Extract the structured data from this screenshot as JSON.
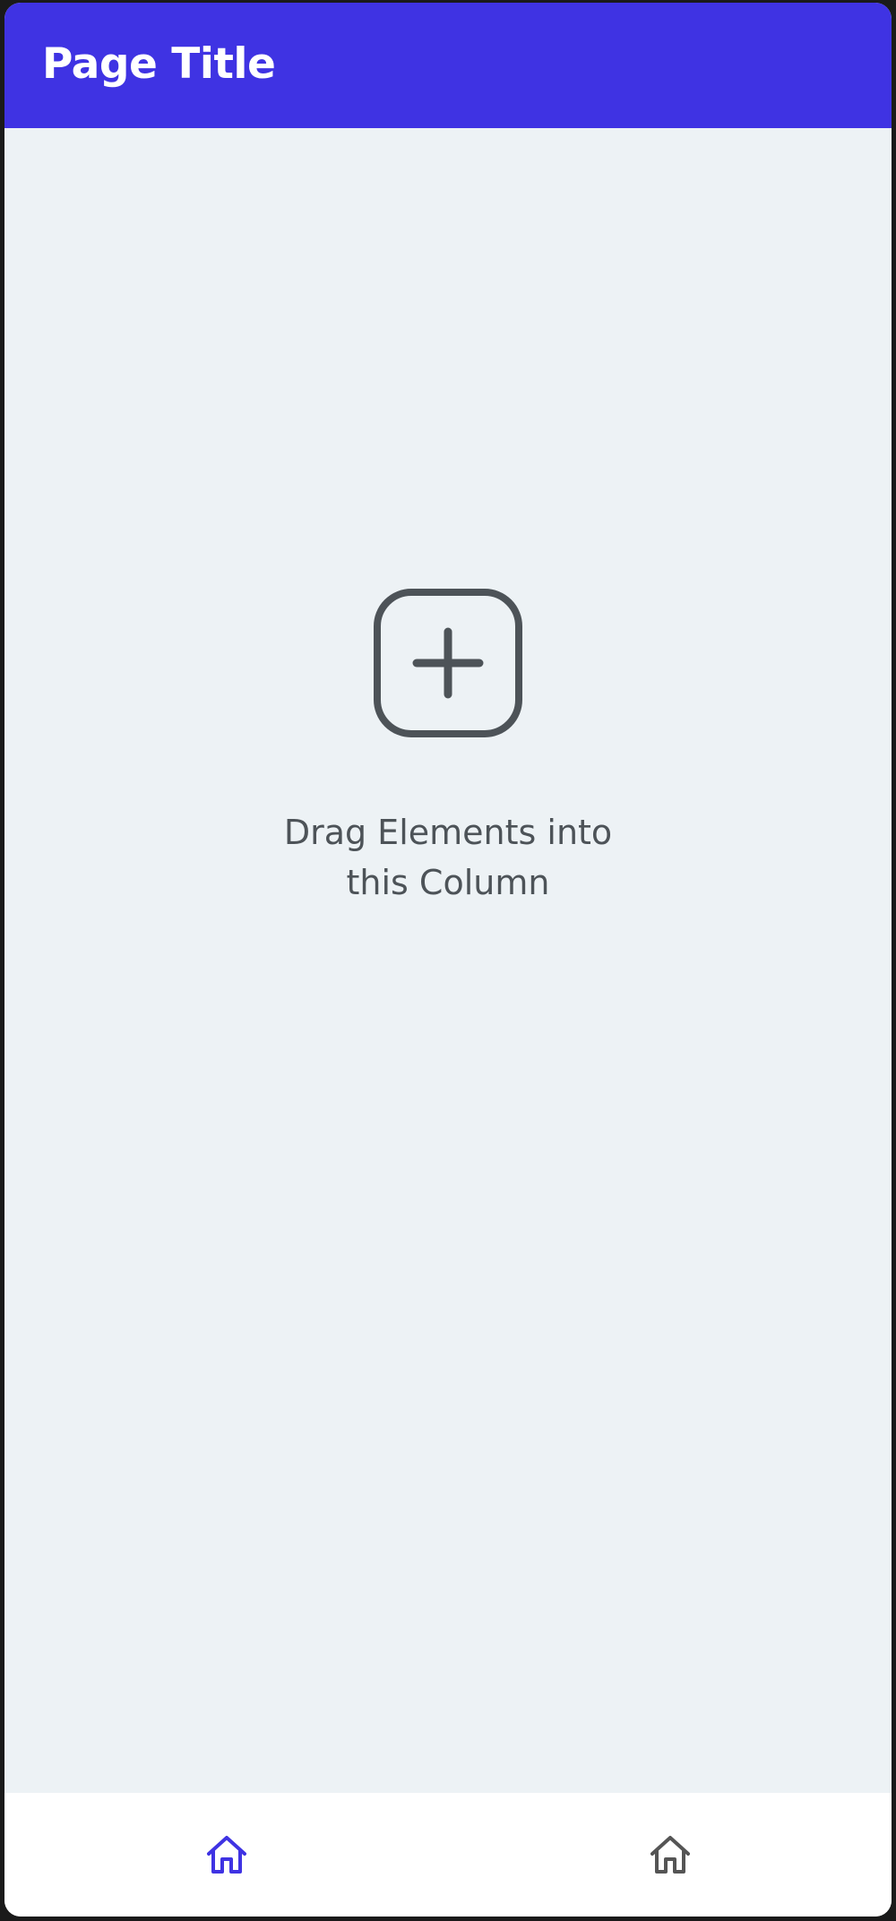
{
  "header": {
    "title": "Page Title"
  },
  "main": {
    "placeholder_icon": "add-square-icon",
    "placeholder_text": "Drag Elements into this Column"
  },
  "bottom_nav": {
    "items": [
      {
        "icon": "home-icon",
        "active": true
      },
      {
        "icon": "home-icon",
        "active": false
      }
    ]
  },
  "colors": {
    "app_bar": "#3f33e3",
    "background": "#edf2f5",
    "icon_stroke": "#4d5358",
    "nav_active": "#3f33e3",
    "nav_inactive": "#555555"
  }
}
